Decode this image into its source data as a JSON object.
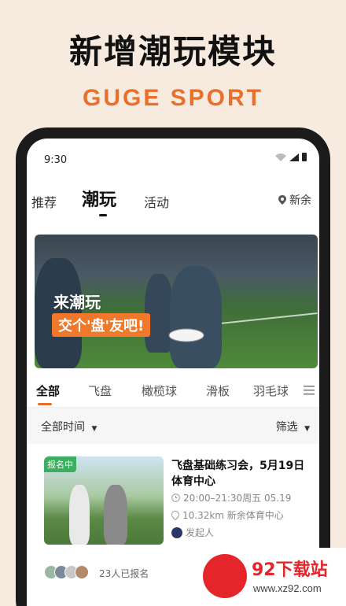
{
  "promo": {
    "headline": "新增潮玩模块",
    "brand": "GUGE SPORT"
  },
  "statusbar": {
    "time": "9:30"
  },
  "topnav": {
    "tabs": [
      {
        "label": "推荐"
      },
      {
        "label": "潮玩"
      },
      {
        "label": "活动"
      }
    ],
    "active": "潮玩",
    "city": "新余"
  },
  "banner": {
    "title": "来潮玩",
    "subtitle": "交个'盘'友吧!"
  },
  "categories": {
    "items": [
      "全部",
      "飞盘",
      "橄榄球",
      "滑板",
      "羽毛球"
    ],
    "active": "全部"
  },
  "filters": {
    "time_label": "全部时间",
    "filter_label": "筛选"
  },
  "card": {
    "status": "报名中",
    "title": "飞盘基础练习会，5月19日体育中心",
    "time": "20:00–21:30周五 05.19",
    "location": "10.32km 新余体育中心",
    "organizer": "发起人",
    "signup": "23人已报名"
  },
  "watermark": {
    "title": "92下载站",
    "url": "www.xz92.com"
  },
  "colors": {
    "accent": "#e8702a",
    "badge": "#3cae5f",
    "background": "#f7ebe0"
  }
}
